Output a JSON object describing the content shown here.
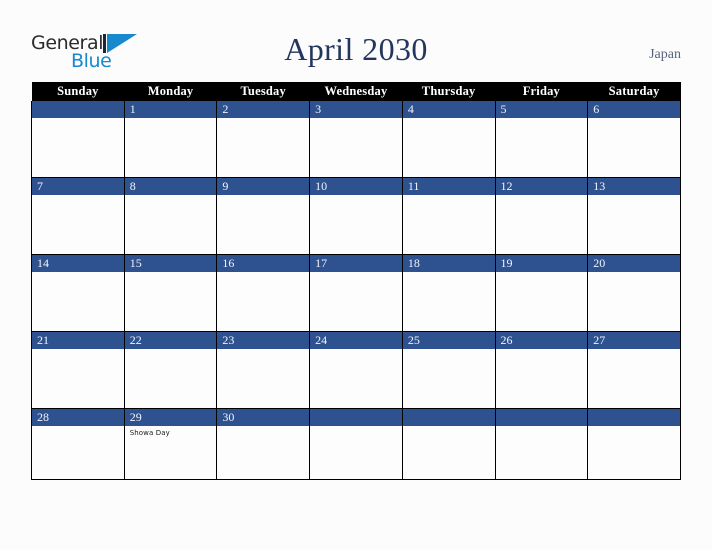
{
  "brand": {
    "name_part1": "General",
    "name_part2": "Blue",
    "triangle_color": "#1789cc",
    "text_color": "#2b2b2b"
  },
  "header": {
    "title": "April 2030",
    "country": "Japan",
    "title_color": "#22365e",
    "country_color": "#55657f"
  },
  "calendar": {
    "month": "April",
    "year": "2030",
    "accent_color": "#2e5290",
    "header_bg": "#000000",
    "weekdays": [
      "Sunday",
      "Monday",
      "Tuesday",
      "Wednesday",
      "Thursday",
      "Friday",
      "Saturday"
    ],
    "weeks": [
      [
        {
          "day": "",
          "events": []
        },
        {
          "day": "1",
          "events": []
        },
        {
          "day": "2",
          "events": []
        },
        {
          "day": "3",
          "events": []
        },
        {
          "day": "4",
          "events": []
        },
        {
          "day": "5",
          "events": []
        },
        {
          "day": "6",
          "events": []
        }
      ],
      [
        {
          "day": "7",
          "events": []
        },
        {
          "day": "8",
          "events": []
        },
        {
          "day": "9",
          "events": []
        },
        {
          "day": "10",
          "events": []
        },
        {
          "day": "11",
          "events": []
        },
        {
          "day": "12",
          "events": []
        },
        {
          "day": "13",
          "events": []
        }
      ],
      [
        {
          "day": "14",
          "events": []
        },
        {
          "day": "15",
          "events": []
        },
        {
          "day": "16",
          "events": []
        },
        {
          "day": "17",
          "events": []
        },
        {
          "day": "18",
          "events": []
        },
        {
          "day": "19",
          "events": []
        },
        {
          "day": "20",
          "events": []
        }
      ],
      [
        {
          "day": "21",
          "events": []
        },
        {
          "day": "22",
          "events": []
        },
        {
          "day": "23",
          "events": []
        },
        {
          "day": "24",
          "events": []
        },
        {
          "day": "25",
          "events": []
        },
        {
          "day": "26",
          "events": []
        },
        {
          "day": "27",
          "events": []
        }
      ],
      [
        {
          "day": "28",
          "events": []
        },
        {
          "day": "29",
          "events": [
            "Showa Day"
          ]
        },
        {
          "day": "30",
          "events": []
        },
        {
          "day": "",
          "events": []
        },
        {
          "day": "",
          "events": []
        },
        {
          "day": "",
          "events": []
        },
        {
          "day": "",
          "events": []
        }
      ]
    ]
  }
}
